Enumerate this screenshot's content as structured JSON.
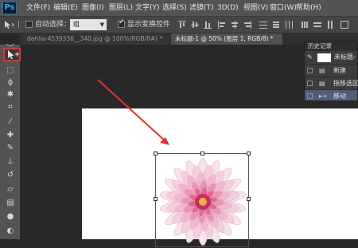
{
  "app": {
    "logo": "Ps"
  },
  "menu": [
    "文件(F)",
    "编辑(E)",
    "图像(I)",
    "图层(L)",
    "文字(Y)",
    "选择(S)",
    "滤镜(T)",
    "3D(D)",
    "视图(V)",
    "窗口(W)",
    "帮助(H)"
  ],
  "options": {
    "auto_select_label": "自动选择：",
    "auto_select_checked": false,
    "layer_select_value": "组",
    "show_transform_label": "显示变换控件",
    "show_transform_checked": true
  },
  "tabs": [
    {
      "label": "dahlia-4539336__340.jpg @ 100%(RGB/8#) *",
      "active": false
    },
    {
      "label": "未标题-1 @ 50% (图层 1, RGB/8) *",
      "active": true
    }
  ],
  "tools": [
    "move-tool-icon",
    "marquee-icon",
    "lasso-icon",
    "magic-wand-icon",
    "crop-icon",
    "eyedropper-icon",
    "healing-brush-icon",
    "brush-icon",
    "clone-stamp-icon",
    "history-brush-icon",
    "eraser-icon",
    "gradient-icon",
    "blur-icon",
    "dodge-icon"
  ],
  "history_panel": {
    "title": "历史记录",
    "snapshot_label": "未标题-",
    "items": [
      {
        "label": "新建",
        "selected": false
      },
      {
        "label": "拖移选区",
        "selected": false
      },
      {
        "label": "移动",
        "selected": true
      }
    ]
  },
  "colors": {
    "menubar": "#535353",
    "annotation": "#e23030",
    "selected_row": "#4f5f7a"
  }
}
